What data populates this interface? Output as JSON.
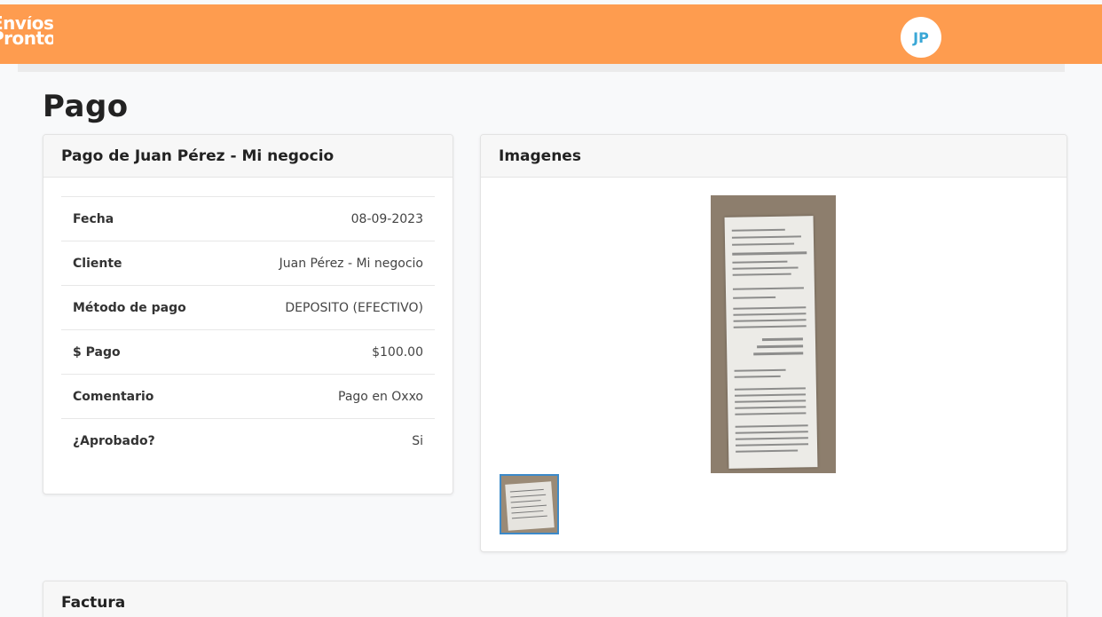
{
  "header": {
    "logo_line1": "Envíos",
    "logo_line2": "Pronto",
    "avatar_initials": "JP",
    "brand_color": "#fe9c4f"
  },
  "page": {
    "title": "Pago"
  },
  "payment_card": {
    "title": "Pago de Juan Pérez - Mi negocio",
    "rows": [
      {
        "label": "Fecha",
        "value": "08-09-2023"
      },
      {
        "label": "Cliente",
        "value": "Juan Pérez - Mi negocio"
      },
      {
        "label": "Método de pago",
        "value": "DEPOSITO (EFECTIVO)"
      },
      {
        "label": "$ Pago",
        "value": "$100.00"
      },
      {
        "label": "Comentario",
        "value": "Pago en Oxxo"
      },
      {
        "label": "¿Aprobado?",
        "value": "Si"
      }
    ]
  },
  "images_card": {
    "title": "Imagenes"
  },
  "invoice_card": {
    "title": "Factura"
  }
}
